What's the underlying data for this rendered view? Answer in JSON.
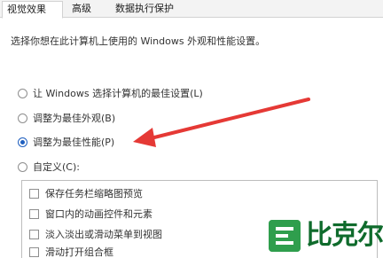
{
  "tabs": [
    {
      "label": "视觉效果",
      "active": true
    },
    {
      "label": "高级",
      "active": false
    },
    {
      "label": "数据执行保护",
      "active": false
    }
  ],
  "description": "选择你想在此计算机上使用的 Windows 外观和性能设置。",
  "radios": [
    {
      "label": "让 Windows 选择计算机的最佳设置(L)",
      "checked": false
    },
    {
      "label": "调整为最佳外观(B)",
      "checked": false
    },
    {
      "label": "调整为最佳性能(P)",
      "checked": true
    },
    {
      "label": "自定义(C):",
      "checked": false
    }
  ],
  "checkboxes": [
    {
      "label": "保存任务栏缩略图预览",
      "checked": false
    },
    {
      "label": "窗口内的动画控件和元素",
      "checked": false
    },
    {
      "label": "淡入淡出或滑动菜单到视图",
      "checked": false
    },
    {
      "label": "滑动打开组合框",
      "checked": false
    }
  ],
  "annotation_arrow": {
    "color": "#e53935",
    "icon": "red-arrow-icon"
  },
  "watermark": {
    "text": "比克尔",
    "color": "#0f6b2c"
  }
}
